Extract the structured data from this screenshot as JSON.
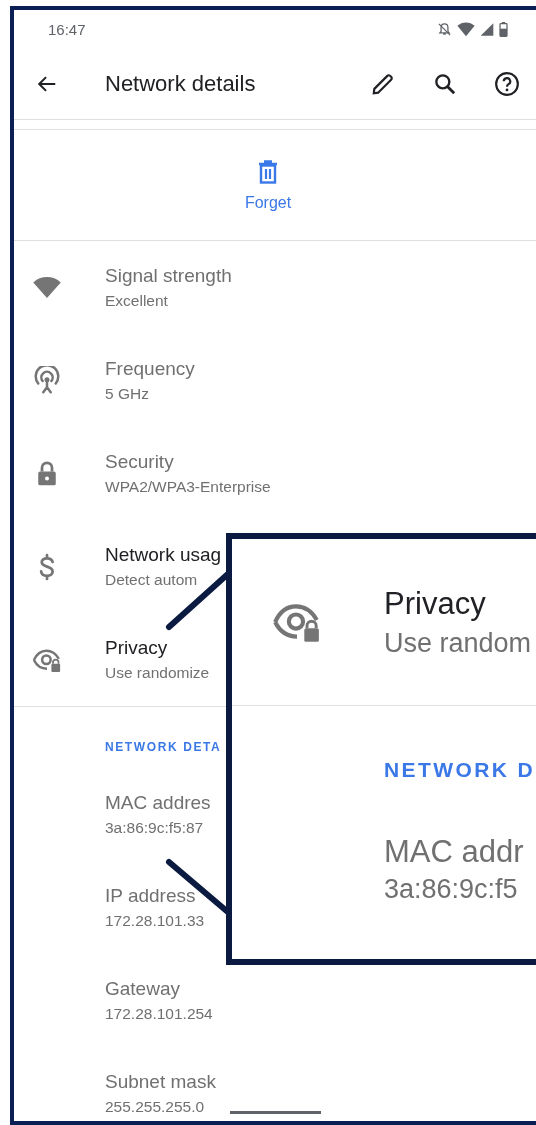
{
  "status_bar": {
    "time": "16:47"
  },
  "app_bar": {
    "title": "Network details"
  },
  "forget": {
    "label": "Forget"
  },
  "rows": [
    {
      "kind": "wifi",
      "title": "Signal strength",
      "subtitle": "Excellent",
      "disabled": true
    },
    {
      "kind": "antenna",
      "title": "Frequency",
      "subtitle": "5 GHz",
      "disabled": true
    },
    {
      "kind": "lock",
      "title": "Security",
      "subtitle": "WPA2/WPA3-Enterprise",
      "disabled": true
    },
    {
      "kind": "dollar",
      "title": "Network usag",
      "subtitle": "Detect autom",
      "disabled": false
    },
    {
      "kind": "privacy",
      "title": "Privacy",
      "subtitle": "Use randomize",
      "disabled": false
    }
  ],
  "section": {
    "header": "NETWORK DETA"
  },
  "details": [
    {
      "title": "MAC addres",
      "value": "3a:86:9c:f5:87"
    },
    {
      "title": "IP address",
      "value": "172.28.101.33"
    },
    {
      "title": "Gateway",
      "value": "172.28.101.254"
    },
    {
      "title": "Subnet mask",
      "value": "255.255.255.0"
    }
  ],
  "callout": {
    "title": "Privacy",
    "subtitle": "Use random",
    "header": "NETWORK D",
    "detail_title": "MAC addr",
    "detail_value": "3a:86:9c:f5"
  }
}
